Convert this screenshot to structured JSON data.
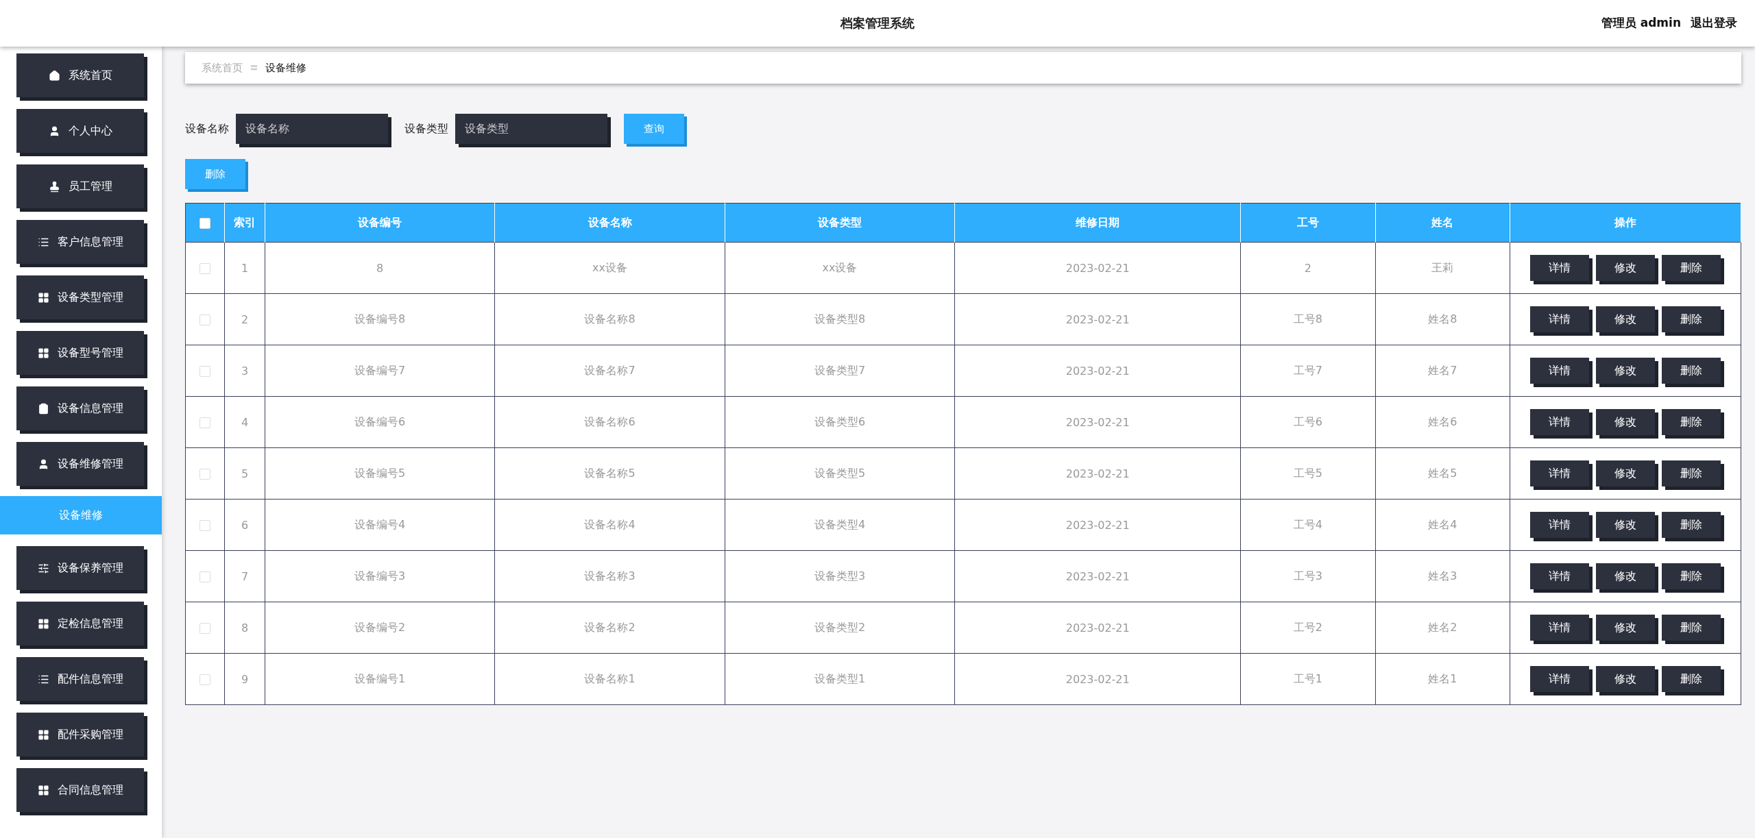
{
  "header": {
    "title": "档案管理系统",
    "user": "管理员 admin",
    "logout": "退出登录"
  },
  "sidebar": {
    "items": [
      {
        "label": "系统首页"
      },
      {
        "label": "个人中心"
      },
      {
        "label": "员工管理"
      },
      {
        "label": "客户信息管理"
      },
      {
        "label": "设备类型管理"
      },
      {
        "label": "设备型号管理"
      },
      {
        "label": "设备信息管理"
      },
      {
        "label": "设备维修管理",
        "children": [
          {
            "label": "设备维修",
            "selected": true
          }
        ]
      },
      {
        "label": "设备保养管理"
      },
      {
        "label": "定检信息管理"
      },
      {
        "label": "配件信息管理"
      },
      {
        "label": "配件采购管理"
      },
      {
        "label": "合同信息管理"
      }
    ]
  },
  "breadcrumb": [
    "系统首页",
    "设备维修"
  ],
  "breadcrumb_separator": "〓",
  "search": {
    "fields": [
      {
        "label": "设备名称",
        "placeholder": "设备名称"
      },
      {
        "label": "设备类型",
        "placeholder": "设备类型"
      }
    ],
    "button": "查询"
  },
  "delete_button": "删除",
  "table": {
    "header_checked": false,
    "columns": [
      "索引",
      "设备编号",
      "设备名称",
      "设备类型",
      "维修日期",
      "工号",
      "姓名",
      "操作"
    ],
    "rows": [
      {
        "checked": false,
        "cells": [
          "1",
          "8",
          "xx设备",
          "xx设备",
          "2023-02-21",
          "2",
          "王莉"
        ],
        "actions": [
          "详情",
          "修改",
          "删除"
        ]
      },
      {
        "checked": false,
        "cells": [
          "2",
          "设备编号8",
          "设备名称8",
          "设备类型8",
          "2023-02-21",
          "工号8",
          "姓名8"
        ],
        "actions": [
          "详情",
          "修改",
          "删除"
        ]
      },
      {
        "checked": false,
        "cells": [
          "3",
          "设备编号7",
          "设备名称7",
          "设备类型7",
          "2023-02-21",
          "工号7",
          "姓名7"
        ],
        "actions": [
          "详情",
          "修改",
          "删除"
        ]
      },
      {
        "checked": false,
        "cells": [
          "4",
          "设备编号6",
          "设备名称6",
          "设备类型6",
          "2023-02-21",
          "工号6",
          "姓名6"
        ],
        "actions": [
          "详情",
          "修改",
          "删除"
        ]
      },
      {
        "checked": false,
        "cells": [
          "5",
          "设备编号5",
          "设备名称5",
          "设备类型5",
          "2023-02-21",
          "工号5",
          "姓名5"
        ],
        "actions": [
          "详情",
          "修改",
          "删除"
        ]
      },
      {
        "checked": false,
        "cells": [
          "6",
          "设备编号4",
          "设备名称4",
          "设备类型4",
          "2023-02-21",
          "工号4",
          "姓名4"
        ],
        "actions": [
          "详情",
          "修改",
          "删除"
        ]
      },
      {
        "checked": false,
        "cells": [
          "7",
          "设备编号3",
          "设备名称3",
          "设备类型3",
          "2023-02-21",
          "工号3",
          "姓名3"
        ],
        "actions": [
          "详情",
          "修改",
          "删除"
        ]
      },
      {
        "checked": false,
        "cells": [
          "8",
          "设备编号2",
          "设备名称2",
          "设备类型2",
          "2023-02-21",
          "工号2",
          "姓名2"
        ],
        "actions": [
          "详情",
          "修改",
          "删除"
        ]
      },
      {
        "checked": false,
        "cells": [
          "9",
          "设备编号1",
          "设备名称1",
          "设备类型1",
          "2023-02-21",
          "工号1",
          "姓名1"
        ],
        "actions": [
          "详情",
          "修改",
          "删除"
        ]
      }
    ]
  }
}
